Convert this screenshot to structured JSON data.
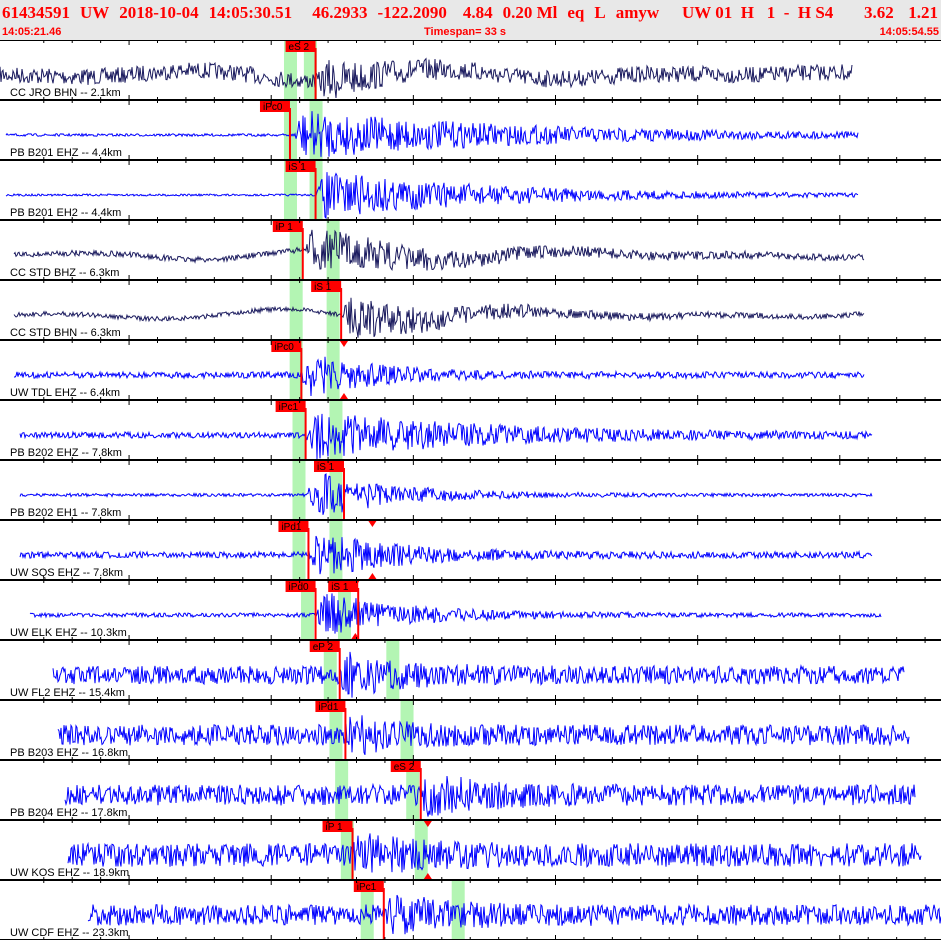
{
  "header": {
    "event_id": "61434591",
    "network": "UW",
    "date": "2018-10-04",
    "origin_time": "14:05:30.51",
    "lat": "46.2933",
    "lon": "-122.2090",
    "depth": "4.84",
    "magnitude": "0.20 Ml",
    "type": "eq",
    "local": "L",
    "author": "amyw",
    "info": "UW 01  H   1  -  H S4",
    "rms": "3.62",
    "gap": "1.21",
    "start_time": "14:05:21.46",
    "timespan": "Timespan=  33 s",
    "end_time": "14:05:54.55"
  },
  "timespan_s": 33.1,
  "colors": {
    "pick": "#ff0000",
    "band": "#b3f5b3",
    "cc": "#1a1a5e",
    "uw": "#0000ff"
  },
  "traces": [
    {
      "label": "CC JRO BHN -- 2.1km",
      "color": "cc",
      "start": 0,
      "end": 30,
      "picks": [
        {
          "label": "eS 2",
          "t": 11.1
        }
      ],
      "bands": [
        10.2,
        10.9
      ],
      "amp": 0.35,
      "onset": 11.2,
      "post": 2.2,
      "lowfreq": true
    },
    {
      "label": "PB B201 EHZ -- 4.4km",
      "color": "uw",
      "start": 0.2,
      "end": 30.2,
      "picks": [
        {
          "label": "iPc0",
          "t": 10.2
        }
      ],
      "bands": [
        10.2,
        11.1
      ],
      "amp": 0.05,
      "onset": 10.3,
      "post": 8
    },
    {
      "label": "PB B201 EH2 -- 4.4km",
      "color": "uw",
      "start": 0.2,
      "end": 30.2,
      "picks": [
        {
          "label": "iS 1",
          "t": 11.1
        }
      ],
      "bands": [
        10.2,
        11.1
      ],
      "amp": 0.04,
      "onset": 11.1,
      "post": 6
    },
    {
      "label": "CC STD BHZ -- 6.3km",
      "color": "cc",
      "start": 0.5,
      "end": 30.4,
      "picks": [
        {
          "label": "iP 1",
          "t": 10.65
        }
      ],
      "bands": [
        10.4,
        11.7
      ],
      "amp": 0.12,
      "onset": 10.7,
      "post": 5,
      "lowfreq": true
    },
    {
      "label": "CC STD BHN -- 6.3km",
      "color": "cc",
      "start": 0.5,
      "end": 30.4,
      "picks": [
        {
          "label": "iS 1",
          "t": 12.0
        }
      ],
      "bands": [
        10.4,
        11.7
      ],
      "amp": 0.1,
      "onset": 12.0,
      "post": 4,
      "lowfreq": true
    },
    {
      "label": "UW TDL EHZ -- 6.4km",
      "color": "uw",
      "start": 0.5,
      "end": 30.4,
      "picks": [
        {
          "label": "iPc0",
          "t": 10.6
        }
      ],
      "bands": [
        10.4,
        11.7
      ],
      "amp": 0.12,
      "onset": 10.6,
      "post": 2.5,
      "marker": 12.1
    },
    {
      "label": "PB B202 EHZ -- 7.8km",
      "color": "uw",
      "start": 0.7,
      "end": 30.7,
      "picks": [
        {
          "label": "iPc1",
          "t": 10.75
        }
      ],
      "bands": [
        10.5,
        11.8
      ],
      "amp": 0.12,
      "onset": 10.75,
      "post": 6
    },
    {
      "label": "PB B202 EH1 -- 7.8km",
      "color": "uw",
      "start": 0.7,
      "end": 30.7,
      "picks": [
        {
          "label": "iS 1",
          "t": 12.1
        }
      ],
      "bands": [
        10.5,
        11.8
      ],
      "amp": 0.06,
      "onset": 10.8,
      "post": 3
    },
    {
      "label": "UW SQS EHZ -- 7.8km",
      "color": "uw",
      "start": 0.7,
      "end": 30.7,
      "picks": [
        {
          "label": "iPd1",
          "t": 10.85
        }
      ],
      "bands": [
        10.5,
        11.8
      ],
      "amp": 0.12,
      "onset": 10.85,
      "post": 3,
      "marker": 13.1
    },
    {
      "label": "UW ELK EHZ -- 10.3km",
      "color": "uw",
      "start": 1.05,
      "end": 31.0,
      "picks": [
        {
          "label": "iPd0",
          "t": 11.1
        },
        {
          "label": "iS 1",
          "t": 12.6
        }
      ],
      "bands": [
        10.8,
        12.1
      ],
      "amp": 0.08,
      "onset": 11.1,
      "post": 3,
      "marker": 12.5
    },
    {
      "label": "UW FL2 EHZ -- 15.4km",
      "color": "uw",
      "start": 1.85,
      "end": 31.8,
      "picks": [
        {
          "label": "eP 2",
          "t": 11.95
        }
      ],
      "bands": [
        11.6,
        13.8
      ],
      "amp": 0.35,
      "onset": 11.95,
      "post": 2
    },
    {
      "label": "PB B203 EHZ -- 16.8km",
      "color": "uw",
      "start": 2.05,
      "end": 32.0,
      "picks": [
        {
          "label": "iPd1",
          "t": 12.15
        }
      ],
      "bands": [
        11.8,
        14.3
      ],
      "amp": 0.4,
      "onset": 12.1,
      "post": 1.5
    },
    {
      "label": "PB B204 EH2 -- 17.8km",
      "color": "uw",
      "start": 2.3,
      "end": 32.2,
      "picks": [
        {
          "label": "eS 2",
          "t": 14.8
        }
      ],
      "bands": [
        12.0,
        14.5
      ],
      "amp": 0.4,
      "onset": 14.8,
      "post": 2
    },
    {
      "label": "UW KOS EHZ -- 18.9km",
      "color": "uw",
      "start": 2.4,
      "end": 32.4,
      "picks": [
        {
          "label": "iP 1",
          "t": 12.4
        }
      ],
      "bands": [
        12.2,
        14.8
      ],
      "amp": 0.45,
      "onset": 12.4,
      "post": 2,
      "marker": 15.05
    },
    {
      "label": "UW CDF EHZ -- 23.3km",
      "color": "uw",
      "start": 3.1,
      "end": 33.1,
      "picks": [
        {
          "label": "iPc1",
          "t": 13.5
        }
      ],
      "bands": [
        12.9,
        16.1
      ],
      "amp": 0.4,
      "onset": 13.5,
      "post": 2
    }
  ]
}
